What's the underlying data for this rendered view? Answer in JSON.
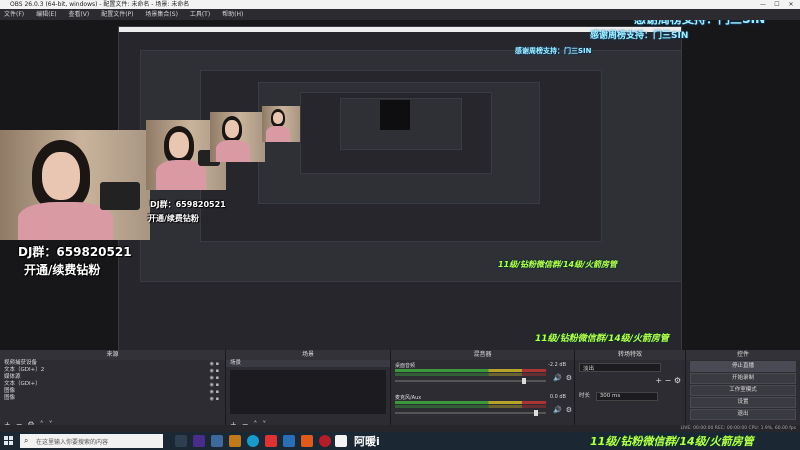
{
  "window": {
    "title": "OBS 26.0.3 (64-bit, windows) - 配置文件: 未命名 - 场景: 未命名",
    "controls": [
      "—",
      "☐",
      "✕"
    ]
  },
  "menu": [
    "文件(F)",
    "编辑(E)",
    "查看(V)",
    "配置文件(P)",
    "场景集合(S)",
    "工具(T)",
    "帮助(H)"
  ],
  "overlays": {
    "thanks": "感谢周榜支持：门三SIN",
    "dj_group": "DJ群：659820521",
    "open_gift": "开通/续费钻粉",
    "group_green": "11级/钻粉微信群/14级/火箭房管",
    "mini_dj": "DJ群：659820521",
    "mini_open": "开通/续费钻粉"
  },
  "docks": {
    "sources": {
      "title": "来源",
      "items": [
        "视频捕获设备",
        "文本（GDI+）2",
        "媒体源",
        "文本（GDI+）",
        "图像",
        "图像"
      ]
    },
    "scenes": {
      "title": "场景",
      "items": [
        "场景"
      ]
    },
    "mixer": {
      "title": "混音器",
      "channels": [
        {
          "name": "桌面音频",
          "db": "-2.2 dB",
          "level": 0.84
        },
        {
          "name": "麦克风/Aux",
          "db": "0.0 dB",
          "level": 0.92
        }
      ]
    },
    "transitions": {
      "title": "转场特效",
      "selected": "淡出",
      "duration_label": "时长",
      "duration_value": "300 ms"
    },
    "controls": {
      "title": "控件",
      "buttons": [
        "停止直播",
        "开始录制",
        "工作室模式",
        "设置",
        "退出"
      ]
    }
  },
  "status": {
    "text": "LIVE: 00:00:00   REC: 00:00:00   CPU: 1.9%, 60.00 fps"
  },
  "taskbar": {
    "search_placeholder": "在这里输入你要搜索的内容",
    "app_text": "阿暖i"
  },
  "colors": {
    "overlay_blue": "#9ff0ff",
    "overlay_green": "#b9ff4a",
    "obs_bg": "#2c2c32",
    "taskbar": "#1b2733"
  }
}
